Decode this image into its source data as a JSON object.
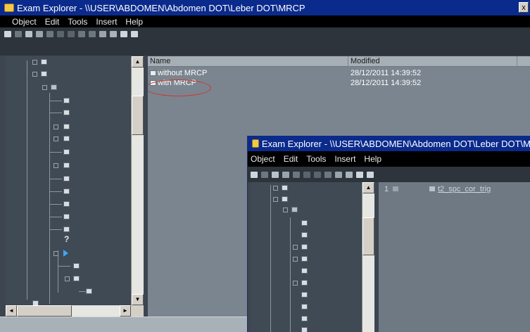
{
  "main_window": {
    "title": "Exam Explorer - \\\\USER\\ABDOMEN\\Abdomen DOT\\Leber DOT\\MRCP",
    "close_glyph": "x",
    "menu": [
      "Object",
      "Edit",
      "Tools",
      "Insert",
      "Help"
    ],
    "list": {
      "columns": [
        "Name",
        "Modified"
      ],
      "rows": [
        {
          "name": "without MRCP",
          "modified": "28/12/2011 14:39:52"
        },
        {
          "name": "with MRCP",
          "modified": "28/12/2011 14:39:52"
        }
      ],
      "highlighted_row": "with MRCP",
      "highlight_color": "#d2332e"
    },
    "tree": {
      "question_mark": "?",
      "scroll_up": "▲",
      "scroll_down": "▼",
      "scroll_left": "◄",
      "scroll_right": "►"
    }
  },
  "overlay_window": {
    "title": "Exam Explorer - \\\\USER\\ABDOMEN\\Abdomen DOT\\Leber DOT\\M",
    "menu": [
      "Object",
      "Edit",
      "Tools",
      "Insert",
      "Help"
    ],
    "list": {
      "rows": [
        {
          "number": "1",
          "name": "t2_spc_cor_trig"
        }
      ]
    },
    "tree": {
      "scroll_up": "▲"
    }
  },
  "colors": {
    "titlebar": "#0a2a8c",
    "menubar": "#000000",
    "tree_bg": "#3f4a55",
    "list_bg": "#7b858f"
  }
}
